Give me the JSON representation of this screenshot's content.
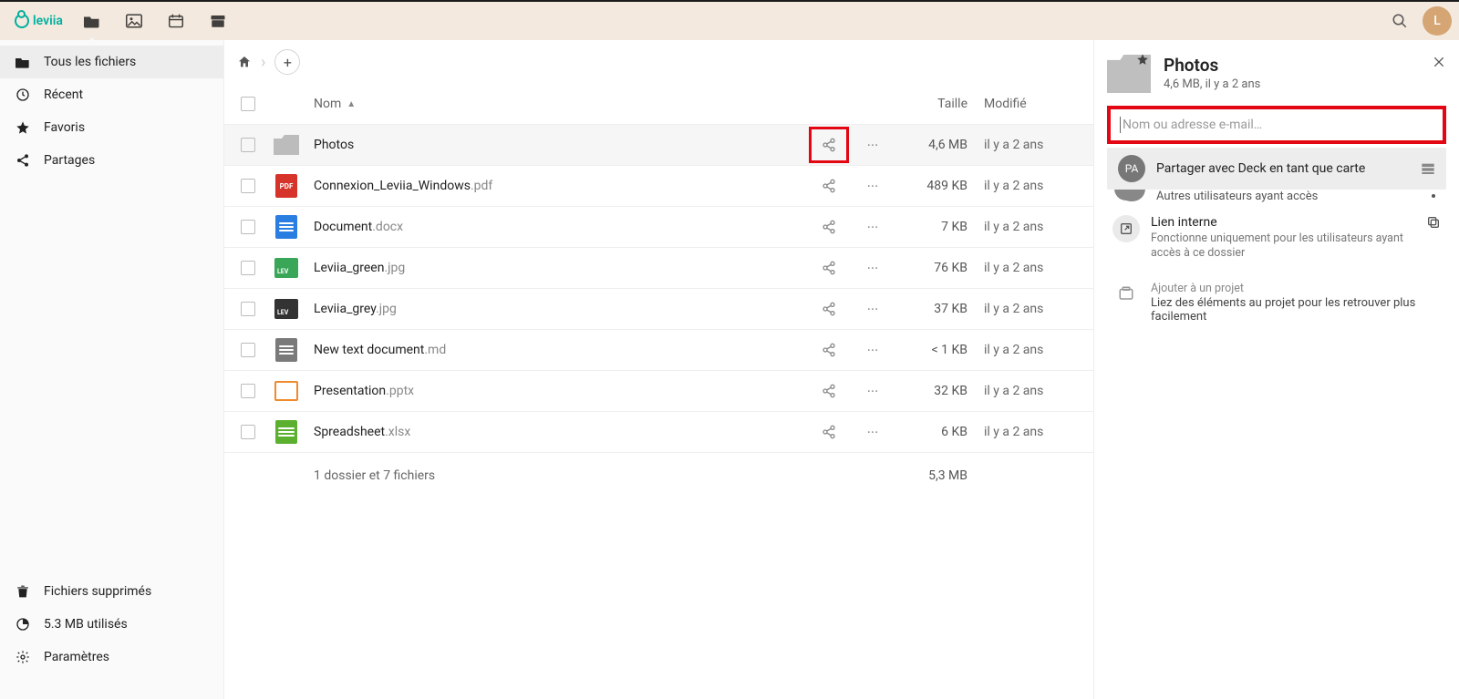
{
  "brand": "leviia",
  "avatar_initial": "L",
  "sidebar": {
    "items": [
      {
        "label": "Tous les fichiers"
      },
      {
        "label": "Récent"
      },
      {
        "label": "Favoris"
      },
      {
        "label": "Partages"
      }
    ],
    "trash": "Fichiers supprimés",
    "quota": "5.3 MB utilisés",
    "settings": "Paramètres"
  },
  "table": {
    "headers": {
      "name": "Nom",
      "size": "Taille",
      "modified": "Modifié"
    },
    "rows": [
      {
        "name": "Photos",
        "ext": "",
        "size": "4,6 MB",
        "modified": "il y a 2 ans",
        "kind": "folder",
        "highlight": true
      },
      {
        "name": "Connexion_Leviia_Windows",
        "ext": ".pdf",
        "size": "489 KB",
        "modified": "il y a 2 ans",
        "kind": "pdf"
      },
      {
        "name": "Document",
        "ext": ".docx",
        "size": "7 KB",
        "modified": "il y a 2 ans",
        "kind": "doc"
      },
      {
        "name": "Leviia_green",
        "ext": ".jpg",
        "size": "76 KB",
        "modified": "il y a 2 ans",
        "kind": "jpg-g"
      },
      {
        "name": "Leviia_grey",
        "ext": ".jpg",
        "size": "37 KB",
        "modified": "il y a 2 ans",
        "kind": "jpg-gr"
      },
      {
        "name": "New text document",
        "ext": ".md",
        "size": "< 1 KB",
        "modified": "il y a 2 ans",
        "kind": "md"
      },
      {
        "name": "Presentation",
        "ext": ".pptx",
        "size": "32 KB",
        "modified": "il y a 2 ans",
        "kind": "ppt"
      },
      {
        "name": "Spreadsheet",
        "ext": ".xlsx",
        "size": "6 KB",
        "modified": "il y a 2 ans",
        "kind": "xls"
      }
    ],
    "summary_text": "1 dossier et 7 fichiers",
    "summary_size": "5,3 MB"
  },
  "details": {
    "title": "Photos",
    "subtitle": "4,6 MB, il y a 2 ans",
    "search_placeholder": "Nom ou adresse e-mail…",
    "deck_badge": "PA",
    "deck_label": "Partager avec Deck en tant que carte",
    "others_label": "Autres utilisateurs ayant accès",
    "internal_title": "Lien interne",
    "internal_sub": "Fonctionne uniquement pour les utilisateurs ayant accès à ce dossier",
    "project_title": "Ajouter à un projet",
    "project_sub": "Liez des éléments au projet pour les retrouver plus facilement"
  }
}
